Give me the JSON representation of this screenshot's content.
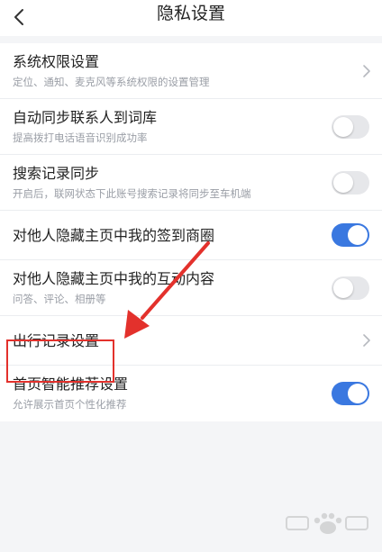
{
  "header": {
    "title": "隐私设置",
    "back_icon": "chevron-left-icon"
  },
  "settings": [
    {
      "title": "系统权限设置",
      "subtitle": "定位、通知、麦克风等系统权限的设置管理",
      "control": "chevron"
    },
    {
      "title": "自动同步联系人到词库",
      "subtitle": "提高拨打电话语音识别成功率",
      "control": "toggle",
      "enabled": false
    },
    {
      "title": "搜索记录同步",
      "subtitle": "开启后，联网状态下此账号搜索记录将同步至车机端",
      "control": "toggle",
      "enabled": false
    },
    {
      "title": "对他人隐藏主页中我的签到商圈",
      "subtitle": "",
      "control": "toggle",
      "enabled": true
    },
    {
      "title": "对他人隐藏主页中我的互动内容",
      "subtitle": "问答、评论、相册等",
      "control": "toggle",
      "enabled": false
    },
    {
      "title": "出行记录设置",
      "subtitle": "",
      "control": "chevron"
    },
    {
      "title": "首页智能推荐设置",
      "subtitle": "允许展示首页个性化推荐",
      "control": "toggle",
      "enabled": true
    }
  ],
  "annotation": {
    "color": "#e3312c",
    "highlighted_item": "出行记录设置"
  },
  "colors": {
    "toggle_on": "#3a78e0",
    "toggle_off": "#e6e7ea",
    "background": "#f4f5f7"
  }
}
